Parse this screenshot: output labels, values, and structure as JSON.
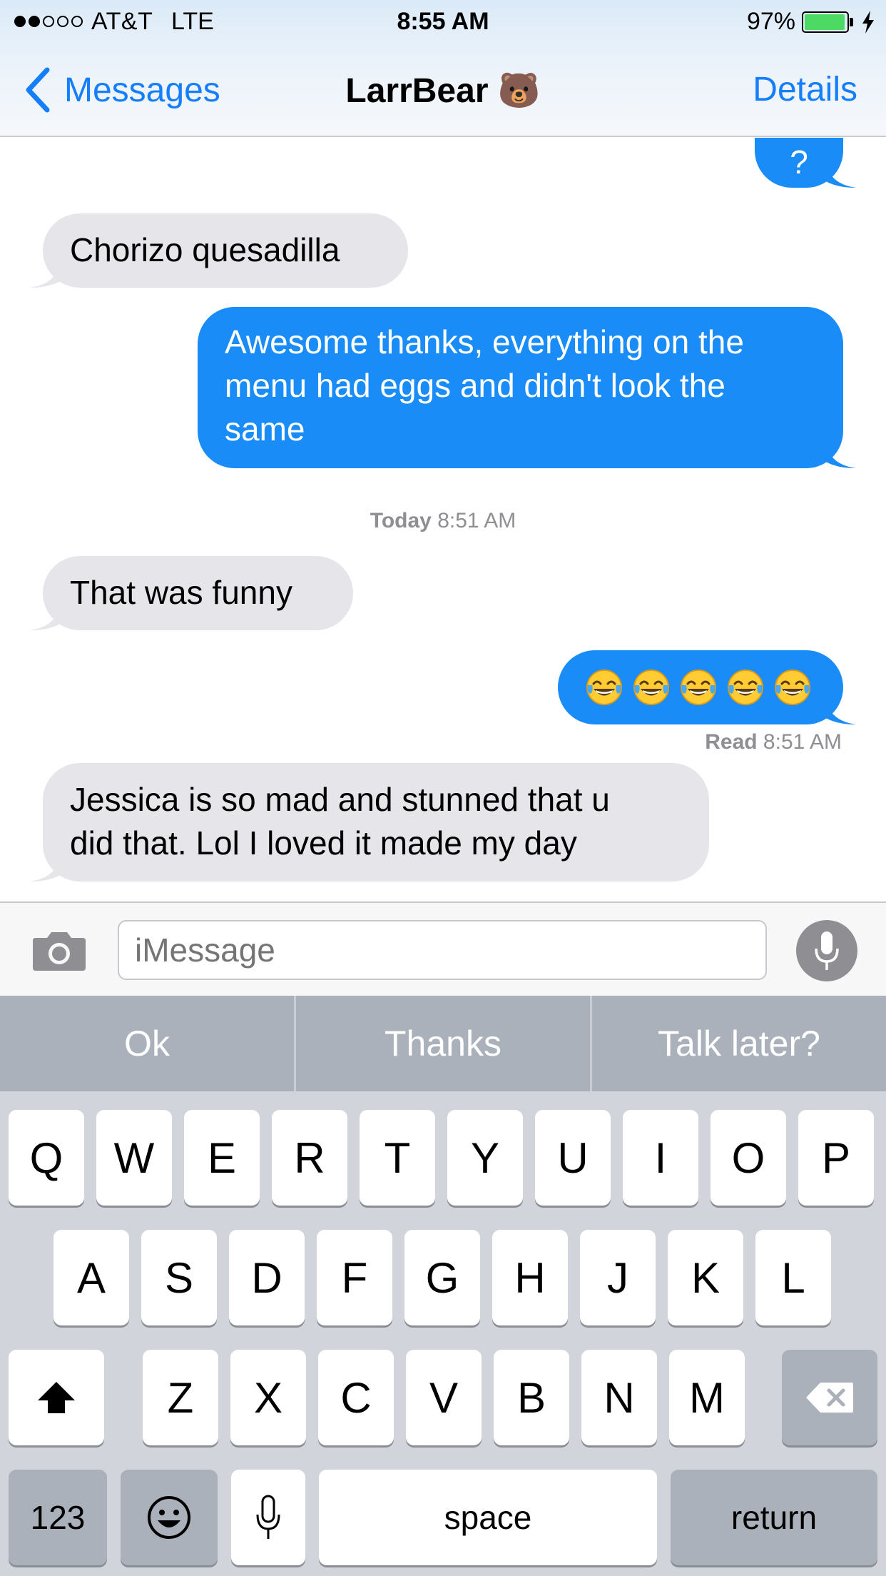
{
  "status_bar": {
    "carrier": "AT&T",
    "network": "LTE",
    "time": "8:55 AM",
    "battery": "97%",
    "battery_level": 0.97,
    "signal_bars_filled": 2,
    "signal_bars_total": 5
  },
  "nav": {
    "back_label": "Messages",
    "title": "LarrBear 🐻",
    "details_label": "Details"
  },
  "messages": [
    {
      "direction": "outgoing",
      "text": "?"
    },
    {
      "direction": "incoming",
      "text": "Chorizo quesadilla"
    },
    {
      "direction": "outgoing",
      "text": "Awesome thanks, everything on the\nmenu had eggs and didn't look the\nsame"
    },
    {
      "direction": "incoming",
      "text": "That was funny"
    },
    {
      "direction": "outgoing",
      "emoji": "face-with-tears-of-joy",
      "emoji_count": 5
    },
    {
      "direction": "incoming",
      "text": "Jessica is so mad and stunned that u\ndid that. Lol I loved it made my day"
    }
  ],
  "timestamp": {
    "day": "Today",
    "time": "8:51 AM"
  },
  "read_receipt": {
    "label": "Read",
    "time": "8:51 AM"
  },
  "compose": {
    "placeholder": "iMessage"
  },
  "keyboard": {
    "suggestions": [
      "Ok",
      "Thanks",
      "Talk later?"
    ],
    "row1": [
      "Q",
      "W",
      "E",
      "R",
      "T",
      "Y",
      "U",
      "I",
      "O",
      "P"
    ],
    "row2": [
      "A",
      "S",
      "D",
      "F",
      "G",
      "H",
      "J",
      "K",
      "L"
    ],
    "row3": [
      "Z",
      "X",
      "C",
      "V",
      "B",
      "N",
      "M"
    ],
    "numbers_key": "123",
    "space_key": "space",
    "return_key": "return"
  },
  "colors": {
    "ios_blue": "#147efb",
    "outgoing_bubble": "#1a8cf8",
    "incoming_bubble": "#e5e5ea",
    "battery_green": "#4cd964",
    "keyboard_bg": "#d1d5db",
    "suggestion_bar": "#aab1bb"
  }
}
